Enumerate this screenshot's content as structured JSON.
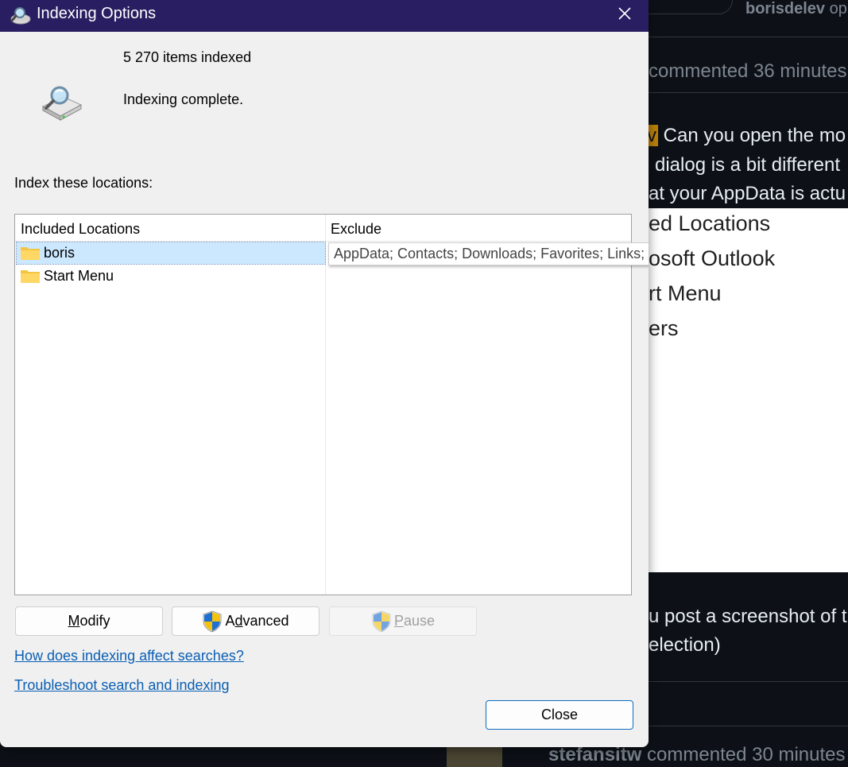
{
  "background": {
    "username": "borisdelev",
    "username_suffix": "op",
    "comment_header": "commented 36 minutes",
    "mention": "v",
    "line1": " Can you open the mo",
    "line2": "dialog is a bit different",
    "line3": "at your AppData is actu",
    "shot_line1": "ed Locations",
    "shot_line2": "osoft Outlook",
    "shot_line3": "rt Menu",
    "shot_line4": "ers",
    "line4": "u post a screenshot of t",
    "line5": "election)",
    "footer_user": "stefansitw",
    "footer_text": " commented 30 minutes"
  },
  "dialog": {
    "title": "Indexing Options",
    "items_indexed": "5 270 items indexed",
    "status": "Indexing complete.",
    "locations_label": "Index these locations:",
    "columns": {
      "included": "Included Locations",
      "exclude": "Exclude"
    },
    "rows": [
      {
        "name": "boris",
        "selected": true
      },
      {
        "name": "Start Menu",
        "selected": false
      }
    ],
    "exclude_tooltip": "AppData; Contacts; Downloads; Favorites; Links; Saved Games; Searches",
    "buttons": {
      "modify_accel": "M",
      "modify_rest": "odify",
      "advanced_pre": "A",
      "advanced_accel": "d",
      "advanced_rest": "vanced",
      "pause_accel": "P",
      "pause_rest": "ause"
    },
    "links": {
      "how": "How does indexing affect searches?",
      "troubleshoot": "Troubleshoot search and indexing"
    },
    "close_label": "Close"
  },
  "colors": {
    "titlebar": "#2a1e62",
    "link": "#0a5fb4",
    "selection": "#cce8ff",
    "close_border": "#0f6cbd"
  },
  "icons": {
    "title": "indexing-options-icon",
    "drive": "search-drive-icon",
    "folder": "folder-icon",
    "shield": "uac-shield-icon",
    "close": "close-icon"
  }
}
